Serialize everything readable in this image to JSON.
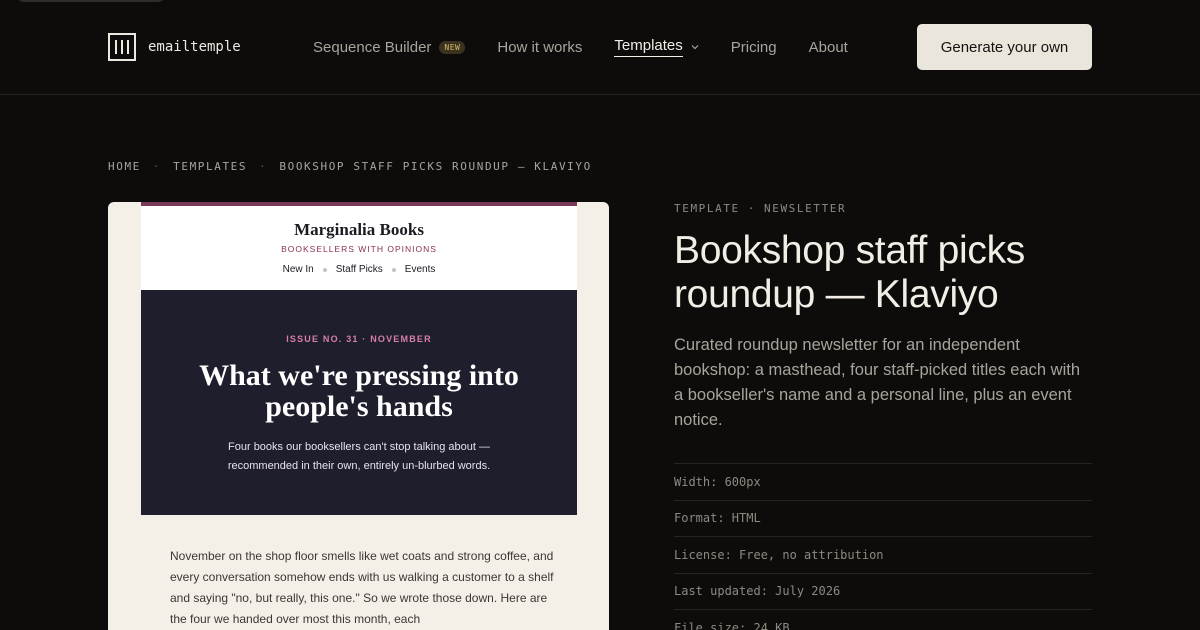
{
  "header": {
    "logo_text": "emailtemple",
    "nav": [
      {
        "label": "Sequence Builder",
        "badge": "NEW"
      },
      {
        "label": "How it works"
      },
      {
        "label": "Templates",
        "active": true,
        "has_dropdown": true
      },
      {
        "label": "Pricing"
      },
      {
        "label": "About"
      }
    ],
    "cta_label": "Generate your own"
  },
  "breadcrumb": [
    "HOME",
    "TEMPLATES",
    "BOOKSHOP STAFF PICKS ROUNDUP — KLAVIYO"
  ],
  "breadcrumb_separator": "·",
  "preview": {
    "brand": "Marginalia Books",
    "tagline": "BOOKSELLERS WITH OPINIONS",
    "nav": [
      "New In",
      "Staff Picks",
      "Events"
    ],
    "issue": "ISSUE NO. 31 · NOVEMBER",
    "headline": "What we're pressing into people's hands",
    "subhead": "Four books our booksellers can't stop talking about — recommended in their own, entirely un-blurbed words.",
    "body": "November on the shop floor smells like wet coats and strong coffee, and every conversation somehow ends with us walking a customer to a shelf and saying \"no, but really, this one.\" So we wrote those down. Here are the four we handed over most this month, each",
    "colors": {
      "accent": "#7a3a5a",
      "hero_bg": "#1e1e2c",
      "issue": "#d77fa6",
      "page_bg": "#f4f0e8"
    }
  },
  "meta": {
    "eyebrow": [
      "TEMPLATE",
      "·",
      "NEWSLETTER"
    ],
    "title": "Bookshop staff picks roundup — Klaviyo",
    "description": "Curated roundup newsletter for an independent bookshop: a masthead, four staff-picked titles each with a bookseller's name and a personal line, plus an event notice.",
    "specs": [
      "Width: 600px",
      "Format: HTML",
      "License: Free, no attribution",
      "Last updated: July 2026",
      "File size: 24 KB"
    ]
  },
  "icons": {
    "logo": "three-bars-logo-icon",
    "dropdown": "chevron-down-icon"
  }
}
